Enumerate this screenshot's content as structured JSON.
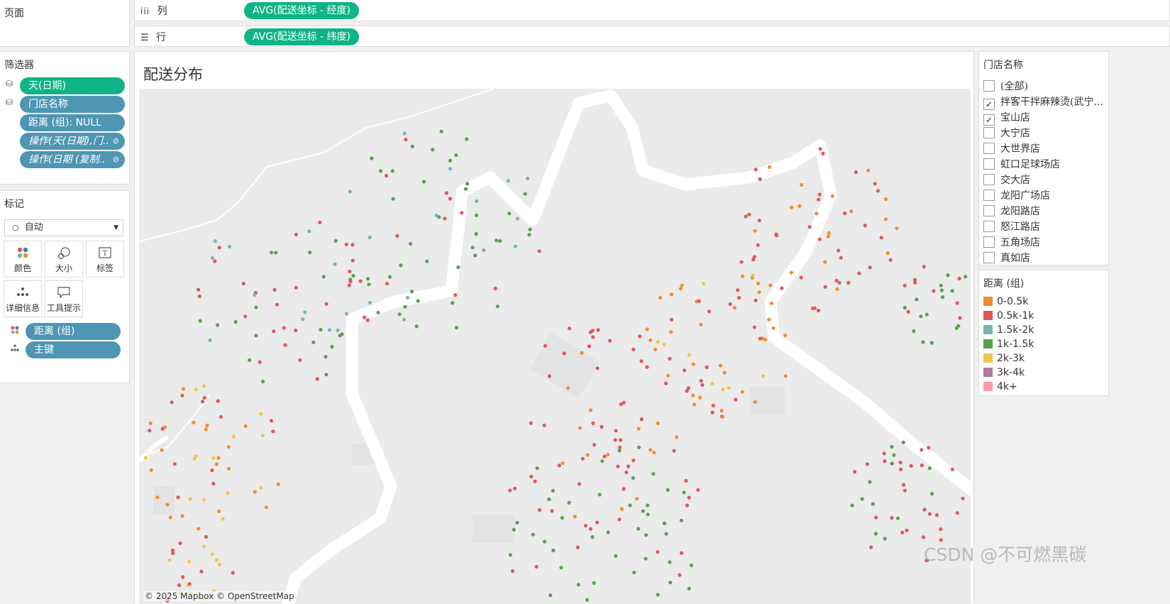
{
  "pages_panel": {
    "title": "页面"
  },
  "columns_shelf": {
    "icon": "iii",
    "label": "列",
    "pill": "AVG(配送坐标 - 经度)"
  },
  "rows_shelf": {
    "icon": "☰",
    "label": "行",
    "pill": "AVG(配送坐标 - 纬度)"
  },
  "filters": {
    "title": "筛选器",
    "pills": [
      {
        "label": "天(日期)",
        "color": "green",
        "italic": false
      },
      {
        "label": "门店名称",
        "color": "blue",
        "italic": false
      },
      {
        "label": "距离 (组): NULL",
        "color": "blue",
        "italic": false
      },
      {
        "label": "操作(天(日期),门..",
        "color": "blue",
        "italic": true
      },
      {
        "label": "操作(日期 (复制..",
        "color": "blue",
        "italic": true
      }
    ]
  },
  "marks": {
    "title": "标记",
    "type_select": "自动",
    "buttons": [
      {
        "label": "颜色",
        "icon": "color-icon"
      },
      {
        "label": "大小",
        "icon": "size-icon"
      },
      {
        "label": "标签",
        "icon": "label-icon"
      },
      {
        "label": "详细信息",
        "icon": "detail-icon"
      },
      {
        "label": "工具提示",
        "icon": "tooltip-icon"
      }
    ],
    "fields": [
      {
        "label": "距离 (组)",
        "icon": "color-icon"
      },
      {
        "label": "主键",
        "icon": "detail-icon"
      }
    ]
  },
  "view": {
    "title": "配送分布",
    "attribution": "© 2025 Mapbox © OpenStreetMap"
  },
  "store_filter": {
    "title": "门店名称",
    "items": [
      {
        "label": "(全部)",
        "checked": false
      },
      {
        "label": "拌客干拌麻辣烫(武宁...",
        "checked": true
      },
      {
        "label": "宝山店",
        "checked": true
      },
      {
        "label": "大宁店",
        "checked": false
      },
      {
        "label": "大世界店",
        "checked": false
      },
      {
        "label": "虹口足球场店",
        "checked": false
      },
      {
        "label": "交大店",
        "checked": false
      },
      {
        "label": "龙阳广场店",
        "checked": false
      },
      {
        "label": "龙阳路店",
        "checked": false
      },
      {
        "label": "怒江路店",
        "checked": false
      },
      {
        "label": "五角场店",
        "checked": false
      },
      {
        "label": "真如店",
        "checked": false
      }
    ]
  },
  "distance_legend": {
    "title": "距离 (组)",
    "items": [
      {
        "label": "0-0.5k",
        "color": "#f28e2b"
      },
      {
        "label": "0.5k-1k",
        "color": "#e15759"
      },
      {
        "label": "1.5k-2k",
        "color": "#76b7b2"
      },
      {
        "label": "1k-1.5k",
        "color": "#59a14f"
      },
      {
        "label": "2k-3k",
        "color": "#edc948"
      },
      {
        "label": "3k-4k",
        "color": "#b07aa1"
      },
      {
        "label": "4k+",
        "color": "#ff9da7"
      }
    ]
  },
  "watermark": "CSDN @不可燃黑碳"
}
